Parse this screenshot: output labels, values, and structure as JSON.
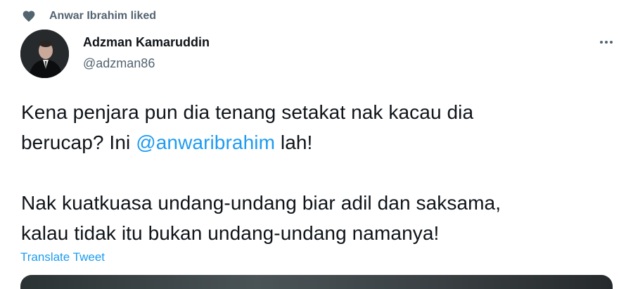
{
  "social_context": {
    "icon": "heart-icon",
    "text": "Anwar Ibrahim liked"
  },
  "author": {
    "display_name": "Adzman Kamaruddin",
    "handle": "@adzman86",
    "avatar": "avatar"
  },
  "more_menu": {
    "icon": "more-dots-icon"
  },
  "tweet": {
    "line1": "Kena penjara pun dia tenang setakat nak kacau dia",
    "line2_before": "berucap? Ini ",
    "mention": "@anwaribrahim",
    "line2_after": " lah!",
    "line3": "Nak kuatkuasa undang-undang biar adil dan saksama,",
    "line4": "kalau tidak itu bukan undang-undang namanya!"
  },
  "translate_label": "Translate Tweet",
  "colors": {
    "text_primary": "#0f1419",
    "text_secondary": "#536471",
    "accent": "#1d9bf0"
  }
}
